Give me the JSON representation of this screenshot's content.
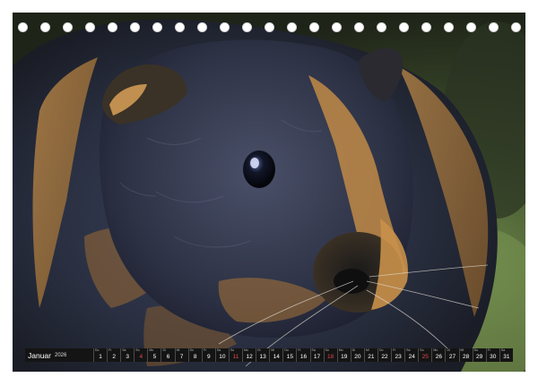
{
  "calendar": {
    "month": "Januar",
    "year": "2026",
    "days": [
      {
        "n": "1",
        "dow": "Do",
        "sunday": false
      },
      {
        "n": "2",
        "dow": "Fr",
        "sunday": false
      },
      {
        "n": "3",
        "dow": "Sa",
        "sunday": false
      },
      {
        "n": "4",
        "dow": "So",
        "sunday": true
      },
      {
        "n": "5",
        "dow": "Mo",
        "sunday": false
      },
      {
        "n": "6",
        "dow": "Di",
        "sunday": false
      },
      {
        "n": "7",
        "dow": "Mi",
        "sunday": false
      },
      {
        "n": "8",
        "dow": "Do",
        "sunday": false
      },
      {
        "n": "9",
        "dow": "Fr",
        "sunday": false
      },
      {
        "n": "10",
        "dow": "Sa",
        "sunday": false
      },
      {
        "n": "11",
        "dow": "So",
        "sunday": true
      },
      {
        "n": "12",
        "dow": "Mo",
        "sunday": false
      },
      {
        "n": "13",
        "dow": "Di",
        "sunday": false
      },
      {
        "n": "14",
        "dow": "Mi",
        "sunday": false
      },
      {
        "n": "15",
        "dow": "Do",
        "sunday": false
      },
      {
        "n": "16",
        "dow": "Fr",
        "sunday": false
      },
      {
        "n": "17",
        "dow": "Sa",
        "sunday": false
      },
      {
        "n": "18",
        "dow": "So",
        "sunday": true
      },
      {
        "n": "19",
        "dow": "Mo",
        "sunday": false
      },
      {
        "n": "20",
        "dow": "Di",
        "sunday": false
      },
      {
        "n": "21",
        "dow": "Mi",
        "sunday": false
      },
      {
        "n": "22",
        "dow": "Do",
        "sunday": false
      },
      {
        "n": "23",
        "dow": "Fr",
        "sunday": false
      },
      {
        "n": "24",
        "dow": "Sa",
        "sunday": false
      },
      {
        "n": "25",
        "dow": "So",
        "sunday": true
      },
      {
        "n": "26",
        "dow": "Mo",
        "sunday": false
      },
      {
        "n": "27",
        "dow": "Di",
        "sunday": false
      },
      {
        "n": "28",
        "dow": "Mi",
        "sunday": false
      },
      {
        "n": "29",
        "dow": "Do",
        "sunday": false
      },
      {
        "n": "30",
        "dow": "Fr",
        "sunday": false
      },
      {
        "n": "31",
        "dow": "Sa",
        "sunday": false
      }
    ]
  },
  "colors": {
    "sunday": "#e0474c",
    "bar": "#141414",
    "page": "#ffffff"
  }
}
